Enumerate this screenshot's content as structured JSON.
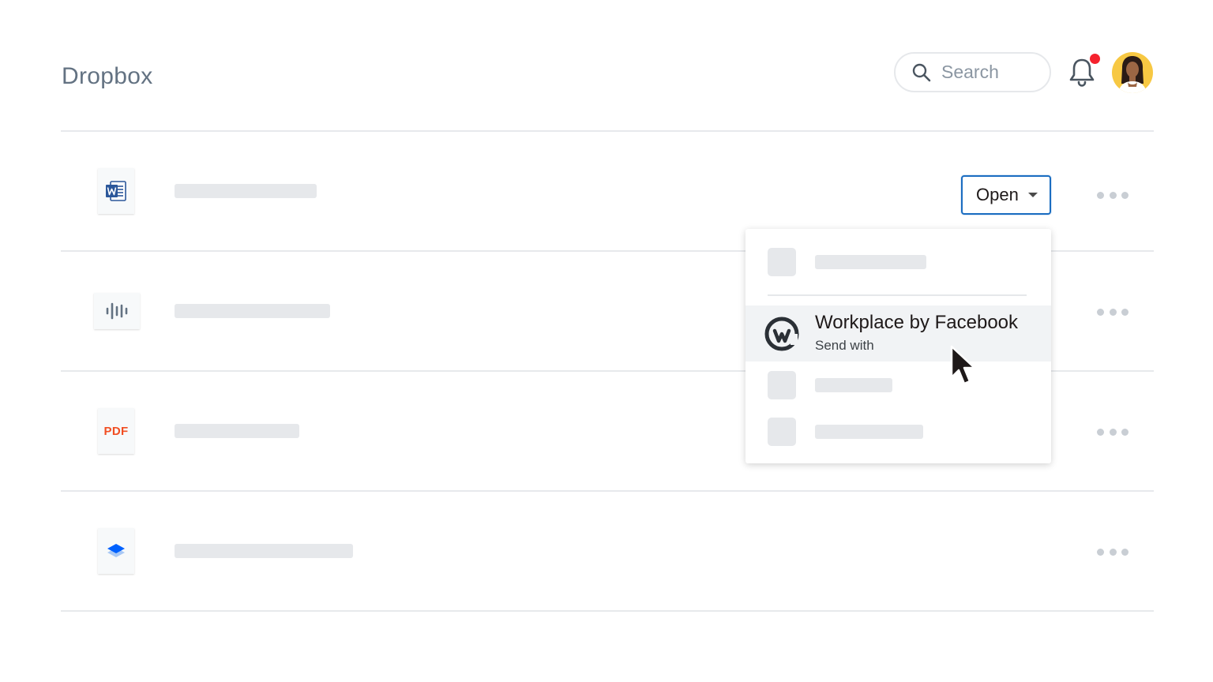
{
  "header": {
    "app_title": "Dropbox",
    "search_placeholder": "Search",
    "has_notification": true
  },
  "files": [
    {
      "type": "word",
      "icon": "word-doc-icon"
    },
    {
      "type": "audio",
      "icon": "audio-waveform-icon"
    },
    {
      "type": "pdf",
      "icon": "pdf-file-icon",
      "icon_text": "PDF"
    },
    {
      "type": "stack",
      "icon": "dropbox-paper-stack-icon"
    }
  ],
  "open_button": {
    "label": "Open"
  },
  "dropdown": {
    "highlighted_item": {
      "title": "Workplace by Facebook",
      "subtitle": "Send with",
      "icon": "workplace-logo-icon"
    }
  },
  "colors": {
    "accent": "#1b6dc1",
    "title_gray": "#637282",
    "skeleton": "#e6e8eb",
    "pdf_red": "#f14e22",
    "word_blue": "#2b579a",
    "notification_red": "#f5222d",
    "avatar_bg": "#f7c843"
  }
}
